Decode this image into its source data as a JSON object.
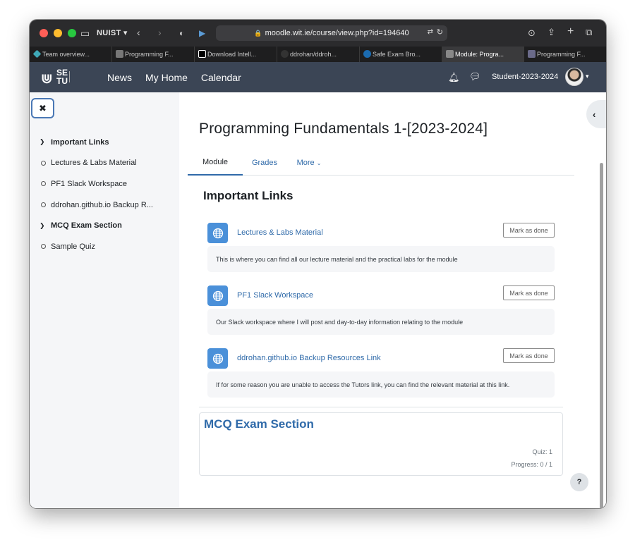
{
  "browser": {
    "profile": "NUIST",
    "url": "moodle.wit.ie/course/view.php?id=194640",
    "tabs": [
      {
        "label": "Team overview...",
        "favicon": "diamond-icon",
        "color": "#3fa9b8"
      },
      {
        "label": "Programming F...",
        "favicon": "moodle-icon",
        "color": "#5a5a5a"
      },
      {
        "label": "Download Intell...",
        "favicon": "intellij-icon",
        "color": "#000000"
      },
      {
        "label": "ddrohan/ddroh...",
        "favicon": "github-icon",
        "color": "#333333"
      },
      {
        "label": "Safe Exam Bro...",
        "favicon": "seb-icon",
        "color": "#1b6bb0"
      },
      {
        "label": "Module: Progra...",
        "favicon": "moodle-icon",
        "color": "#888888"
      },
      {
        "label": "Programming F...",
        "favicon": "d-icon",
        "color": "#6b6b8a"
      }
    ],
    "active_tab_index": 5
  },
  "navbar": {
    "logo_text_1": "SE",
    "logo_text_2": "TU",
    "links": [
      "News",
      "My Home",
      "Calendar"
    ],
    "username": "Student-2023-2024"
  },
  "drawer": {
    "items": [
      {
        "label": "Important Links",
        "kind": "section"
      },
      {
        "label": "Lectures & Labs Material",
        "kind": "item"
      },
      {
        "label": "PF1 Slack Workspace",
        "kind": "item"
      },
      {
        "label": "ddrohan.github.io Backup R...",
        "kind": "item"
      },
      {
        "label": "MCQ Exam Section",
        "kind": "section"
      },
      {
        "label": "Sample Quiz",
        "kind": "item"
      }
    ]
  },
  "course": {
    "title": "Programming Fundamentals 1-[2023-2024]",
    "tabs": [
      "Module",
      "Grades",
      "More"
    ],
    "active_tab": "Module"
  },
  "sections": {
    "important_links": {
      "heading": "Important Links",
      "activities": [
        {
          "title": "Lectures & Labs Material",
          "button": "Mark as done",
          "description": "This is where you can find all our lecture material and the practical labs for the module"
        },
        {
          "title": "PF1 Slack Workspace",
          "button": "Mark as done",
          "description": "Our Slack workspace where I will post and day-to-day information relating to the module"
        },
        {
          "title": "ddrohan.github.io Backup Resources Link",
          "button": "Mark as done",
          "description": "If for some reason you are unable to access the Tutors link, you can find the relevant material at this link."
        }
      ]
    },
    "mcq": {
      "heading": "MCQ Exam Section",
      "quiz_count": "Quiz: 1",
      "progress": "Progress: 0 / 1"
    }
  },
  "help_label": "?",
  "colors": {
    "nav_bg": "#3b4555",
    "link": "#2f6aa9",
    "activity_icon": "#4a90d9"
  }
}
